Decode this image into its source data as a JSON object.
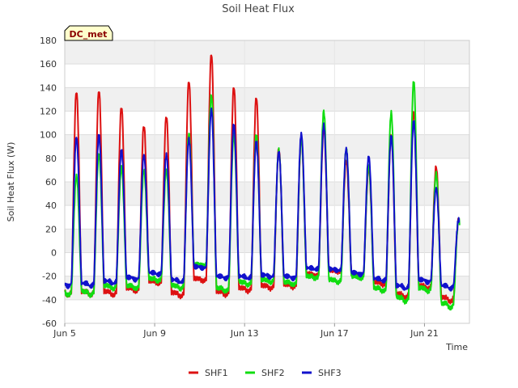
{
  "chart_data": {
    "type": "line",
    "title": "Soil Heat Flux",
    "xlabel": "Time",
    "ylabel": "Soil Heat Flux (W)",
    "badge": "DC_met",
    "xlim": [
      "2023-06-05",
      "2023-06-23"
    ],
    "ylim": [
      -60,
      180
    ],
    "yticks": [
      -60,
      -40,
      -20,
      0,
      20,
      40,
      60,
      80,
      100,
      120,
      140,
      160,
      180
    ],
    "xticks": [
      {
        "date": "2023-06-05",
        "label": "Jun 5"
      },
      {
        "date": "2023-06-09",
        "label": "Jun 9"
      },
      {
        "date": "2023-06-13",
        "label": "Jun 13"
      },
      {
        "date": "2023-06-17",
        "label": "Jun 17"
      },
      {
        "date": "2023-06-21",
        "label": "Jun 21"
      }
    ],
    "grid": true,
    "background_bands": true,
    "legend_position": "bottom",
    "days": [
      "2023-06-05",
      "2023-06-06",
      "2023-06-07",
      "2023-06-08",
      "2023-06-09",
      "2023-06-10",
      "2023-06-11",
      "2023-06-12",
      "2023-06-13",
      "2023-06-14",
      "2023-06-15",
      "2023-06-16",
      "2023-06-17",
      "2023-06-18",
      "2023-06-19",
      "2023-06-20",
      "2023-06-21",
      "2023-06-22"
    ],
    "series": [
      {
        "name": "SHF1",
        "color": "#dd1111",
        "daily_peak": [
          137,
          138,
          124,
          108,
          116,
          146,
          169,
          141,
          132,
          88,
          96,
          105,
          78,
          71,
          100,
          120,
          73,
          28
        ],
        "daily_min": [
          -33,
          -33,
          -30,
          -24,
          -34,
          -22,
          -33,
          -30,
          -28,
          -27,
          -18,
          -15,
          -18,
          -25,
          -35,
          -28,
          -38,
          -32
        ]
      },
      {
        "name": "SHF2",
        "color": "#11dd11",
        "daily_peak": [
          65,
          84,
          72,
          70,
          70,
          101,
          134,
          100,
          100,
          87,
          97,
          120,
          88,
          74,
          119,
          146,
          67,
          28
        ],
        "daily_min": [
          -33,
          -28,
          -28,
          -22,
          -28,
          -10,
          -30,
          -25,
          -23,
          -25,
          -20,
          -23,
          -20,
          -30,
          -38,
          -30,
          -43,
          -40
        ]
      },
      {
        "name": "SHF3",
        "color": "#1111cc",
        "daily_peak": [
          98,
          100,
          87,
          83,
          83,
          96,
          122,
          109,
          94,
          86,
          101,
          108,
          88,
          82,
          99,
          112,
          55,
          28
        ],
        "daily_min": [
          -26,
          -24,
          -21,
          -17,
          -23,
          -12,
          -20,
          -20,
          -19,
          -20,
          -13,
          -14,
          -17,
          -22,
          -28,
          -23,
          -28,
          -21
        ]
      }
    ]
  }
}
